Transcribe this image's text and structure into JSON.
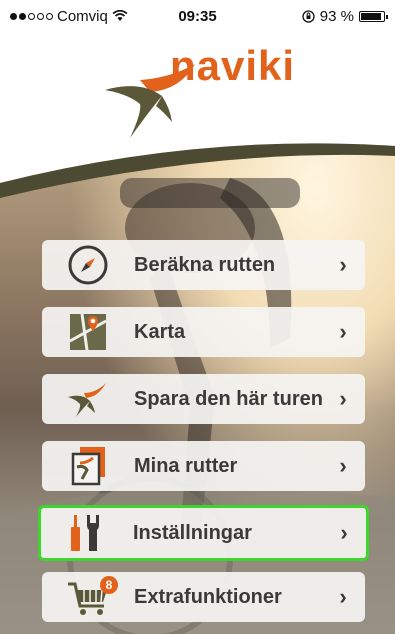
{
  "status_bar": {
    "carrier": "Comviq",
    "time": "09:35",
    "battery_percent": "93 %",
    "battery_level": 0.93
  },
  "brand": {
    "name": "naviki",
    "accent_color": "#e2611b",
    "dark_color": "#4d4a33",
    "highlight_color": "#3cd62d"
  },
  "menu": {
    "items": [
      {
        "label": "Beräkna rutten",
        "icon": "compass-icon",
        "chevron": "›"
      },
      {
        "label": "Karta",
        "icon": "map-icon",
        "chevron": "›"
      },
      {
        "label": "Spara den här turen",
        "icon": "save-route-icon",
        "chevron": "›"
      },
      {
        "label": "Mina rutter",
        "icon": "my-routes-icon",
        "chevron": "›"
      },
      {
        "label": "Inställningar",
        "icon": "settings-tools-icon",
        "chevron": "›",
        "selected": true
      },
      {
        "label": "Extrafunktioner",
        "icon": "cart-icon",
        "chevron": "›",
        "badge": "8"
      }
    ]
  }
}
